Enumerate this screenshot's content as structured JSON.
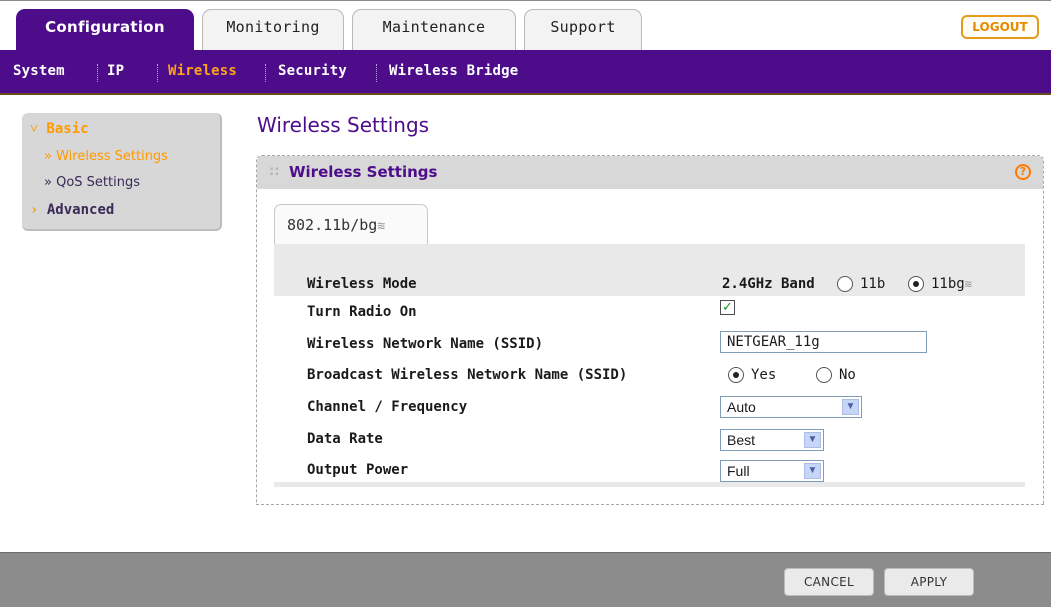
{
  "tabs": [
    {
      "label": "Configuration",
      "active": true
    },
    {
      "label": "Monitoring",
      "active": false
    },
    {
      "label": "Maintenance",
      "active": false
    },
    {
      "label": "Support",
      "active": false
    }
  ],
  "logout_label": "LOGOUT",
  "sub_nav": {
    "items": [
      "System",
      "IP",
      "Wireless",
      "Security",
      "Wireless Bridge"
    ],
    "active": "Wireless"
  },
  "left_nav": {
    "basic": "Basic",
    "basic_items": [
      "Wireless Settings",
      "QoS Settings"
    ],
    "basic_active": "Wireless Settings",
    "advanced": "Advanced"
  },
  "page_title": "Wireless Settings",
  "panel": {
    "title": "Wireless Settings",
    "help_icon": "?",
    "subtab": "802.11b/bg"
  },
  "form": {
    "wireless_mode_label": "Wireless Mode",
    "band_label": "2.4GHz Band",
    "mode_options": [
      {
        "label": "11b",
        "selected": false
      },
      {
        "label": "11bg",
        "selected": true
      }
    ],
    "radio_on_label": "Turn Radio On",
    "radio_on": true,
    "ssid_label": "Wireless Network Name (SSID)",
    "ssid_value": "NETGEAR_11g",
    "broadcast_label": "Broadcast Wireless Network Name (SSID)",
    "broadcast_options": [
      {
        "label": "Yes",
        "selected": true
      },
      {
        "label": "No",
        "selected": false
      }
    ],
    "channel_label": "Channel / Frequency",
    "channel_value": "Auto",
    "data_rate_label": "Data Rate",
    "data_rate_value": "Best",
    "output_power_label": "Output Power",
    "output_power_value": "Full"
  },
  "footer": {
    "cancel_label": "CANCEL",
    "apply_label": "APPLY"
  },
  "colors": {
    "brand_purple": "#4d0d8a",
    "accent_orange": "#ff9a00"
  }
}
